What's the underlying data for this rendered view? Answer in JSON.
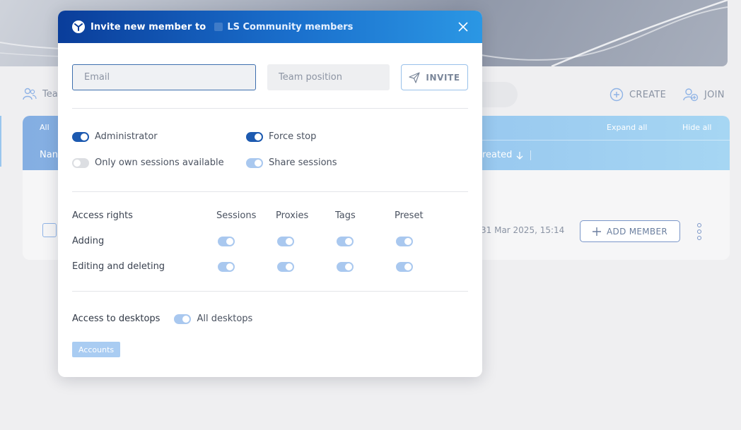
{
  "background": {
    "team_tab_label": "Tea",
    "create_label": "CREATE",
    "join_label": "JOIN",
    "table": {
      "all_label": "All",
      "name_header": "Nan",
      "expand_all": "Expand all",
      "hide_all": "Hide all",
      "created_header": "reated",
      "row_date": "31 Mar 2025, 15:14",
      "add_member_label": "ADD MEMBER"
    }
  },
  "modal": {
    "title": "Invite new member to",
    "team_name": "LS Community members",
    "email": {
      "value": "",
      "placeholder": "Email"
    },
    "position": {
      "value": "",
      "placeholder": "Team position"
    },
    "invite_label": "INVITE",
    "roles": [
      {
        "label": "Administrator",
        "state": "on"
      },
      {
        "label": "Force stop",
        "state": "on"
      },
      {
        "label": "Only own sessions available",
        "state": "off"
      },
      {
        "label": "Share sessions",
        "state": "light"
      }
    ],
    "access_rights": {
      "title": "Access rights",
      "columns": [
        "Sessions",
        "Proxies",
        "Tags",
        "Preset"
      ],
      "rows": [
        {
          "label": "Adding",
          "values": [
            "light",
            "light",
            "light",
            "light"
          ]
        },
        {
          "label": "Editing and deleting",
          "values": [
            "light",
            "light",
            "light",
            "light"
          ]
        }
      ]
    },
    "desktops": {
      "label": "Access to desktops",
      "all_label": "All desktops",
      "all_state": "light",
      "chips": [
        "Accounts"
      ]
    }
  },
  "colors": {
    "header_start": "#0a3d9a",
    "header_end": "#2b97e4",
    "toggle_on": "#1d5ab0",
    "toggle_light": "#a9c8ef",
    "toggle_off": "#dcdee2"
  }
}
